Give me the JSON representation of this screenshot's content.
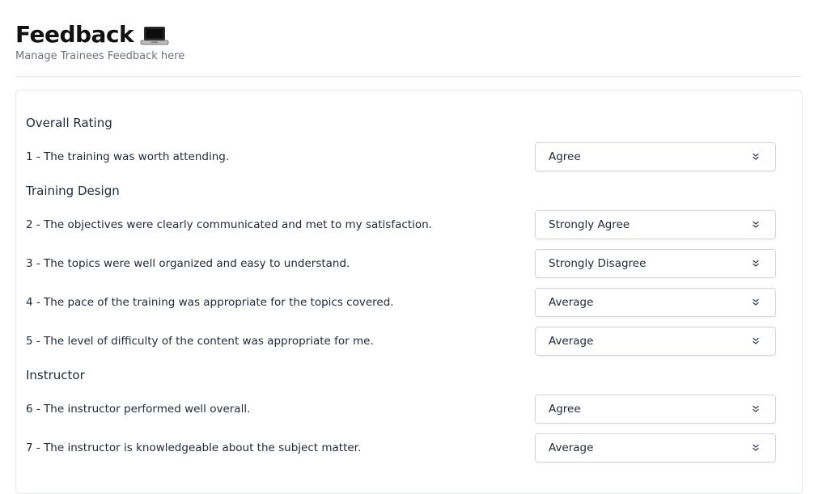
{
  "header": {
    "title": "Feedback",
    "subtitle": "Manage Trainees Feedback here",
    "title_icon": "laptop-icon"
  },
  "sections": [
    {
      "title": "Overall Rating",
      "questions": [
        {
          "text": "1 - The training was worth attending.",
          "answer": "Agree"
        }
      ]
    },
    {
      "title": "Training Design",
      "questions": [
        {
          "text": "2 - The objectives were clearly communicated and met to my satisfaction.",
          "answer": "Strongly Agree"
        },
        {
          "text": "3 - The topics were well organized and easy to understand.",
          "answer": "Strongly Disagree"
        },
        {
          "text": "4 - The pace of the training was appropriate for the topics covered.",
          "answer": "Average"
        },
        {
          "text": "5 - The level of difficulty of the content was appropriate for me.",
          "answer": "Average"
        }
      ]
    },
    {
      "title": "Instructor",
      "questions": [
        {
          "text": "6 - The instructor performed well overall.",
          "answer": "Agree"
        },
        {
          "text": "7 - The instructor is knowledgeable about the subject matter.",
          "answer": "Average"
        }
      ]
    }
  ],
  "colors": {
    "border": "#e5e7eb",
    "text": "#1f2937",
    "muted": "#6b7280"
  }
}
